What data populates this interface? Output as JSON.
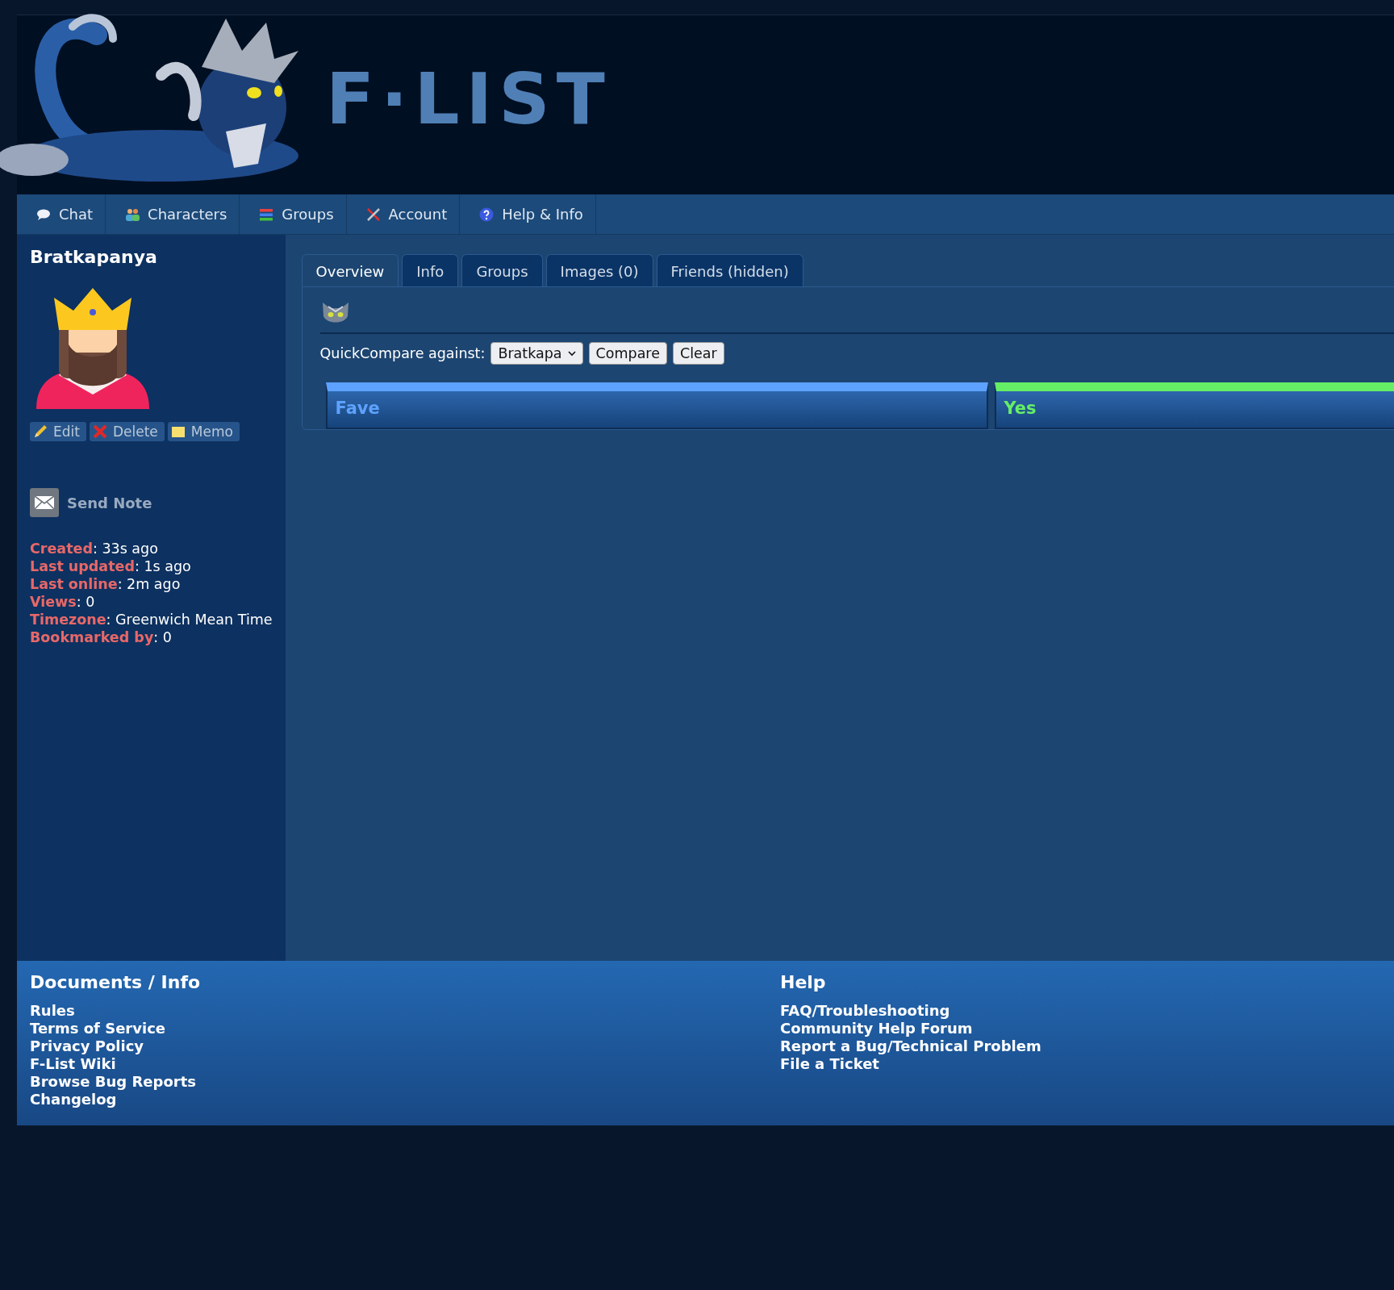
{
  "header": {
    "logo_text": "F·LIST"
  },
  "nav": [
    {
      "label": "Chat"
    },
    {
      "label": "Characters"
    },
    {
      "label": "Groups"
    },
    {
      "label": "Account"
    },
    {
      "label": "Help & Info"
    }
  ],
  "sidebar": {
    "character_name": "Bratkapanya",
    "actions": [
      {
        "label": "Edit"
      },
      {
        "label": "Delete"
      },
      {
        "label": "Memo"
      }
    ],
    "send_note": "Send Note",
    "stats": [
      {
        "label": "Created",
        "value": ": 33s ago"
      },
      {
        "label": "Last updated",
        "value": ": 1s ago"
      },
      {
        "label": "Last online",
        "value": ": 2m ago"
      },
      {
        "label": "Views",
        "value": ": 0"
      },
      {
        "label": "Timezone",
        "value": ": Greenwich Mean Time"
      },
      {
        "label": "Bookmarked by",
        "value": ": 0"
      }
    ]
  },
  "tabs": [
    {
      "label": "Overview",
      "selected": true
    },
    {
      "label": "Info",
      "selected": false
    },
    {
      "label": "Groups",
      "selected": false
    },
    {
      "label": "Images (0)",
      "selected": false
    },
    {
      "label": "Friends (hidden)",
      "selected": false
    }
  ],
  "quick_compare": {
    "label": "QuickCompare against:",
    "select_value": "Bratkapa",
    "buttons": [
      "Compare",
      "Clear"
    ]
  },
  "kink_columns": [
    {
      "title": "Fave",
      "color": "#5ea2ff"
    },
    {
      "title": "Yes",
      "color": "#66ee66"
    }
  ],
  "footer": {
    "sections": [
      {
        "heading": "Documents / Info",
        "links": [
          "Rules",
          "Terms of Service",
          "Privacy Policy",
          "F-List Wiki",
          "Browse Bug Reports",
          "Changelog"
        ]
      },
      {
        "heading": "Help",
        "links": [
          "FAQ/Troubleshooting",
          "Community Help Forum",
          "Report a Bug/Technical Problem",
          "File a Ticket"
        ]
      }
    ]
  }
}
